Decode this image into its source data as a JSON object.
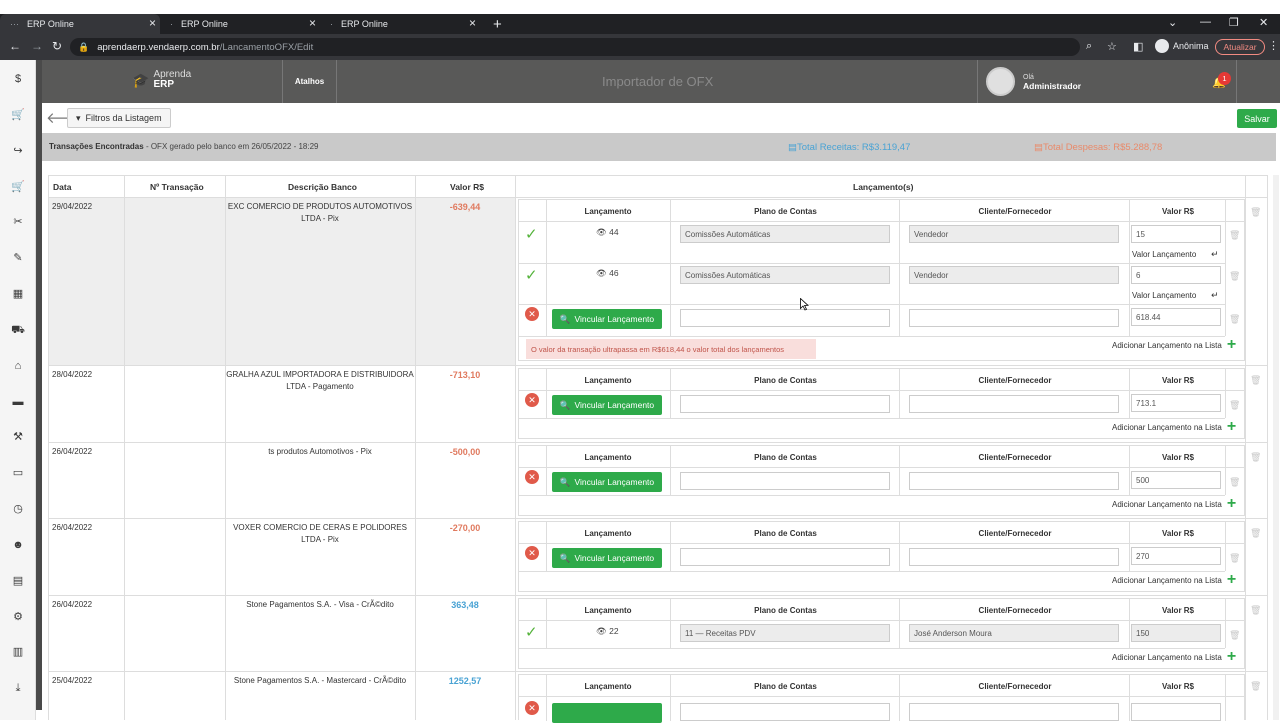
{
  "browser": {
    "tabs": [
      {
        "title": "ERP Online",
        "active": true
      },
      {
        "title": "ERP Online",
        "active": false
      },
      {
        "title": "ERP Online",
        "active": false
      }
    ],
    "url_host": "aprendaerp.vendaerp.com.br",
    "url_path": "/LancamentoOFX/Edit",
    "profile_label": "Anônima",
    "update_label": "Atualizar"
  },
  "app": {
    "logo_line1": "Aprenda",
    "logo_line2": "ERP",
    "atalhos": "Atalhos",
    "title": "Importador de OFX",
    "user_greeting": "Olá",
    "user_name": "Administrador",
    "notification_count": "1"
  },
  "toolbar": {
    "filters_label": "Filtros da Listagem",
    "save_label": "Salvar"
  },
  "summary": {
    "found_label": "Transações Encontradas",
    "found_detail": " - OFX gerado pelo banco em 26/05/2022 - 18:29",
    "total_receitas": "Total Receitas: R$3.119,47",
    "total_despesas": "Total Despesas: R$5.288,78"
  },
  "columns": {
    "data": "Data",
    "transacao": "Nº Transação",
    "descricao": "Descrição Banco",
    "valor": "Valor R$",
    "lancamentos": "Lançamento(s)"
  },
  "sub_columns": {
    "lancamento": "Lançamento",
    "plano": "Plano de Contas",
    "cliente": "Cliente/Fornecedor",
    "valor": "Valor R$"
  },
  "labels": {
    "vincular": "Vincular Lançamento",
    "valor_lancamento": "Valor Lançamento",
    "adicionar": "Adicionar Lançamento na Lista"
  },
  "transactions": [
    {
      "date": "29/04/2022",
      "desc1": "EXC COMERCIO DE PRODUTOS AUTOMOTIVOS",
      "desc2": "LTDA - Pix",
      "value": "-639,44",
      "entries": [
        {
          "id": "44",
          "plano": "Comissões Automáticas",
          "cliente": "Vendedor",
          "valor": "15"
        },
        {
          "id": "46",
          "plano": "Comissões Automáticas",
          "cliente": "Vendedor",
          "valor": "6"
        }
      ],
      "new_value": "618.44",
      "error": "O valor da transação ultrapassa em R$618,44 o valor total dos lançamentos"
    },
    {
      "date": "28/04/2022",
      "desc1": "GRALHA AZUL IMPORTADORA E DISTRIBUIDORA",
      "desc2": "LTDA - Pagamento",
      "value": "-713,10",
      "new_value": "713.1"
    },
    {
      "date": "26/04/2022",
      "desc1": "ts produtos Automotivos - Pix",
      "desc2": "",
      "value": "-500,00",
      "new_value": "500"
    },
    {
      "date": "26/04/2022",
      "desc1": "VOXER COMERCIO DE CERAS E POLIDORES",
      "desc2": "LTDA - Pix",
      "value": "-270,00",
      "new_value": "270"
    },
    {
      "date": "26/04/2022",
      "desc1": "Stone Pagamentos S.A. - Visa - CrÃ©dito",
      "desc2": "",
      "value": "363,48",
      "entry": {
        "id": "22",
        "plano": "11 — Receitas PDV",
        "cliente": "José Anderson Moura",
        "valor": "150"
      }
    },
    {
      "date": "25/04/2022",
      "desc1": "Stone Pagamentos S.A. - Mastercard - CrÃ©dito",
      "desc2": "",
      "value": "1252,57"
    }
  ],
  "colors": {
    "accent_green": "#2eaa4a",
    "negative": "#e07a5f",
    "positive": "#4aa3d4",
    "header_bg": "#595958"
  }
}
